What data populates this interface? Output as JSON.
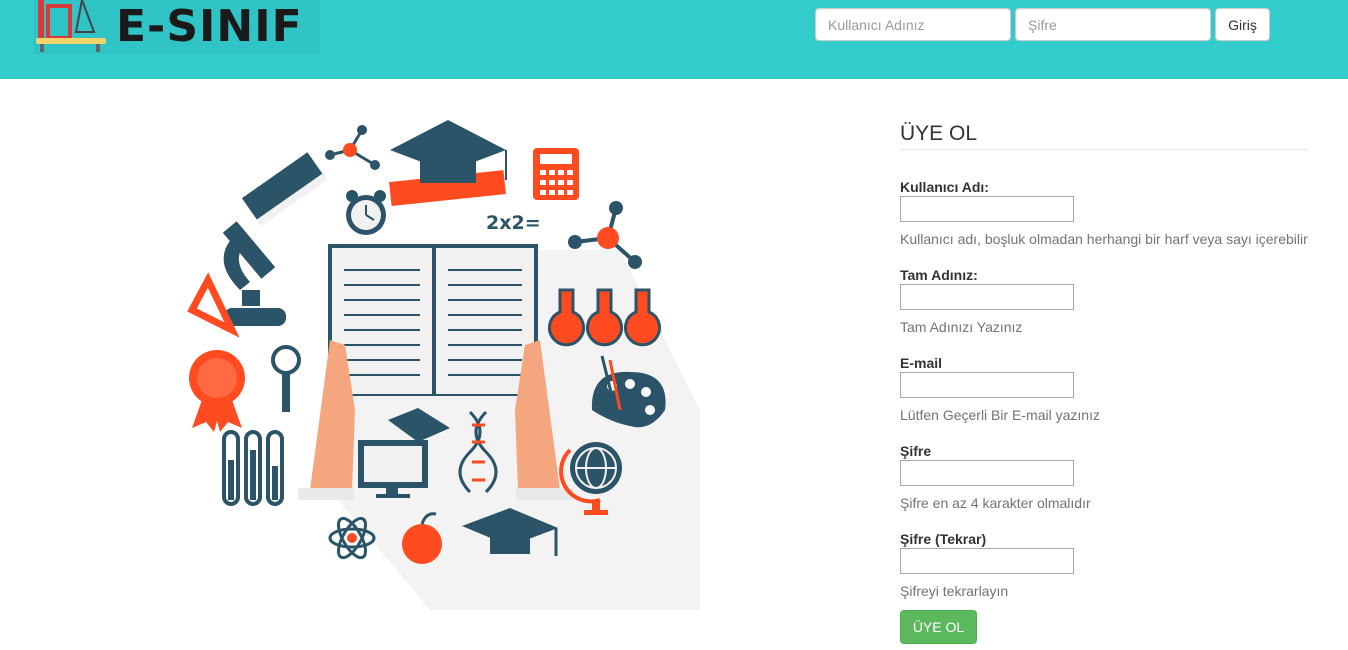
{
  "header": {
    "logo_text": "E-SINIF",
    "username_placeholder": "Kullanıcı Adınız",
    "password_placeholder": "Şifre",
    "login_label": "Giriş"
  },
  "illustration": {
    "equation": "2x2="
  },
  "form": {
    "title": "ÜYE OL",
    "fields": [
      {
        "label": "Kullanıcı Adı:",
        "help": "Kullanıcı adı, boşluk olmadan herhangi bir harf veya sayı içerebilir"
      },
      {
        "label": "Tam Adınız:",
        "help": "Tam Adınızı Yazınız"
      },
      {
        "label": "E-mail",
        "help": "Lütfen Geçerli Bir E-mail yazınız"
      },
      {
        "label": "Şifre",
        "help": "Şifre en az 4 karakter olmalıdır"
      },
      {
        "label": "Şifre (Tekrar)",
        "help": "Şifreyi tekrarlayın"
      }
    ],
    "submit_label": "ÜYE OL"
  },
  "colors": {
    "header_bg": "#33cccc",
    "accent_red": "#ff4b1f",
    "navy": "#2b5468",
    "hand": "#f5a67e",
    "success": "#5cb85c"
  }
}
